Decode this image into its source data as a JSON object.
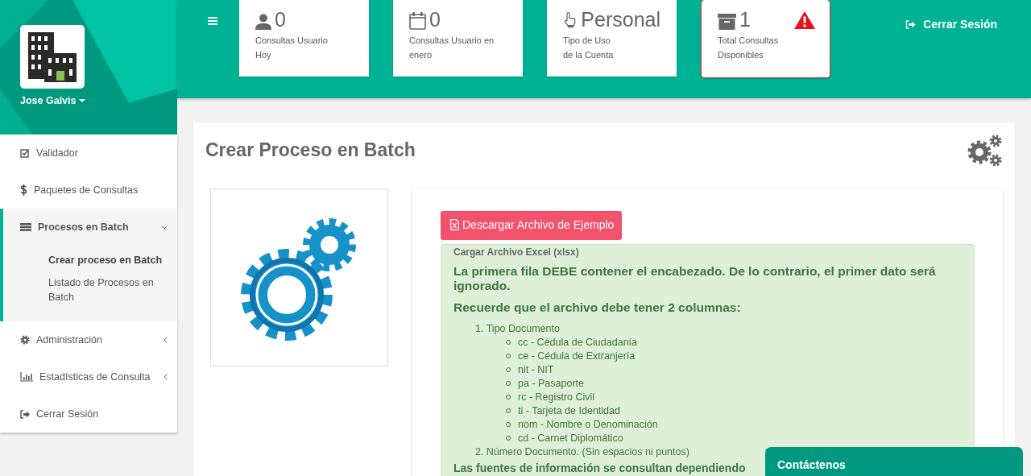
{
  "sidebar": {
    "user": {
      "name": "Jose Galvis"
    },
    "menu": [
      {
        "kind": "link",
        "label": "Validador",
        "selected": false
      },
      {
        "kind": "link",
        "label": "Paquetes de Consultas",
        "selected": false
      },
      {
        "kind": "group",
        "label": "Procesos en Batch",
        "selected": true,
        "expanded": true,
        "children": [
          {
            "label": "Crear proceso en Batch",
            "selected": true
          },
          {
            "label": "Listado de Procesos en Batch",
            "selected": false
          }
        ]
      },
      {
        "kind": "group",
        "label": "Administración",
        "selected": false,
        "expanded": false
      },
      {
        "kind": "group",
        "label": "Estadísticas de Consulta",
        "selected": false,
        "expanded": false
      },
      {
        "kind": "link",
        "label": "Cerrar Sesión",
        "selected": false
      }
    ]
  },
  "topbar": {
    "stats": [
      {
        "value": "0",
        "label_lines": [
          "Consultas Usuario",
          "Hoy"
        ],
        "alert": false
      },
      {
        "value": "0",
        "label_lines": [
          "Consultas Usuario en enero"
        ],
        "alert": false
      },
      {
        "value": "Personal",
        "label_lines": [
          "Tipo de Uso",
          "de la Cuenta"
        ],
        "alert": false
      },
      {
        "value": "1",
        "label_lines": [
          "Total Consultas",
          "Disponibles"
        ],
        "alert": true
      }
    ],
    "logout": "Cerrar Sesión"
  },
  "page": {
    "title": "Crear Proceso en Batch",
    "download_button": "Descargar Archivo de Ejemplo",
    "upload_panel": {
      "label": "Cargar Archivo Excel (xlsx)",
      "notes": [
        "La primera fila DEBE contener el encabezado. De lo contrario, el primer dato será ignorado.",
        "Recuerde que el archivo debe tener 2 columnas:"
      ],
      "columns": [
        {
          "number": "1.",
          "label": "Tipo Documento",
          "options": [
            "cc - Cédula de Ciudadanía",
            "ce - Cédula de Extranjería",
            "nit - NIT",
            "pa - Pasaporte",
            "rc - Registro Civil",
            "ti - Tarjeta de Identidad",
            "nom - Nombre o Denominación",
            "cd - Carnet Diplomático"
          ]
        },
        {
          "number": "2.",
          "label": "Número Documento. (Sin espacios ni puntos)"
        }
      ],
      "footnote": "Las fuentes de información se consultan dependiendo"
    }
  },
  "contact_widget": {
    "label": "Contáctenos"
  }
}
